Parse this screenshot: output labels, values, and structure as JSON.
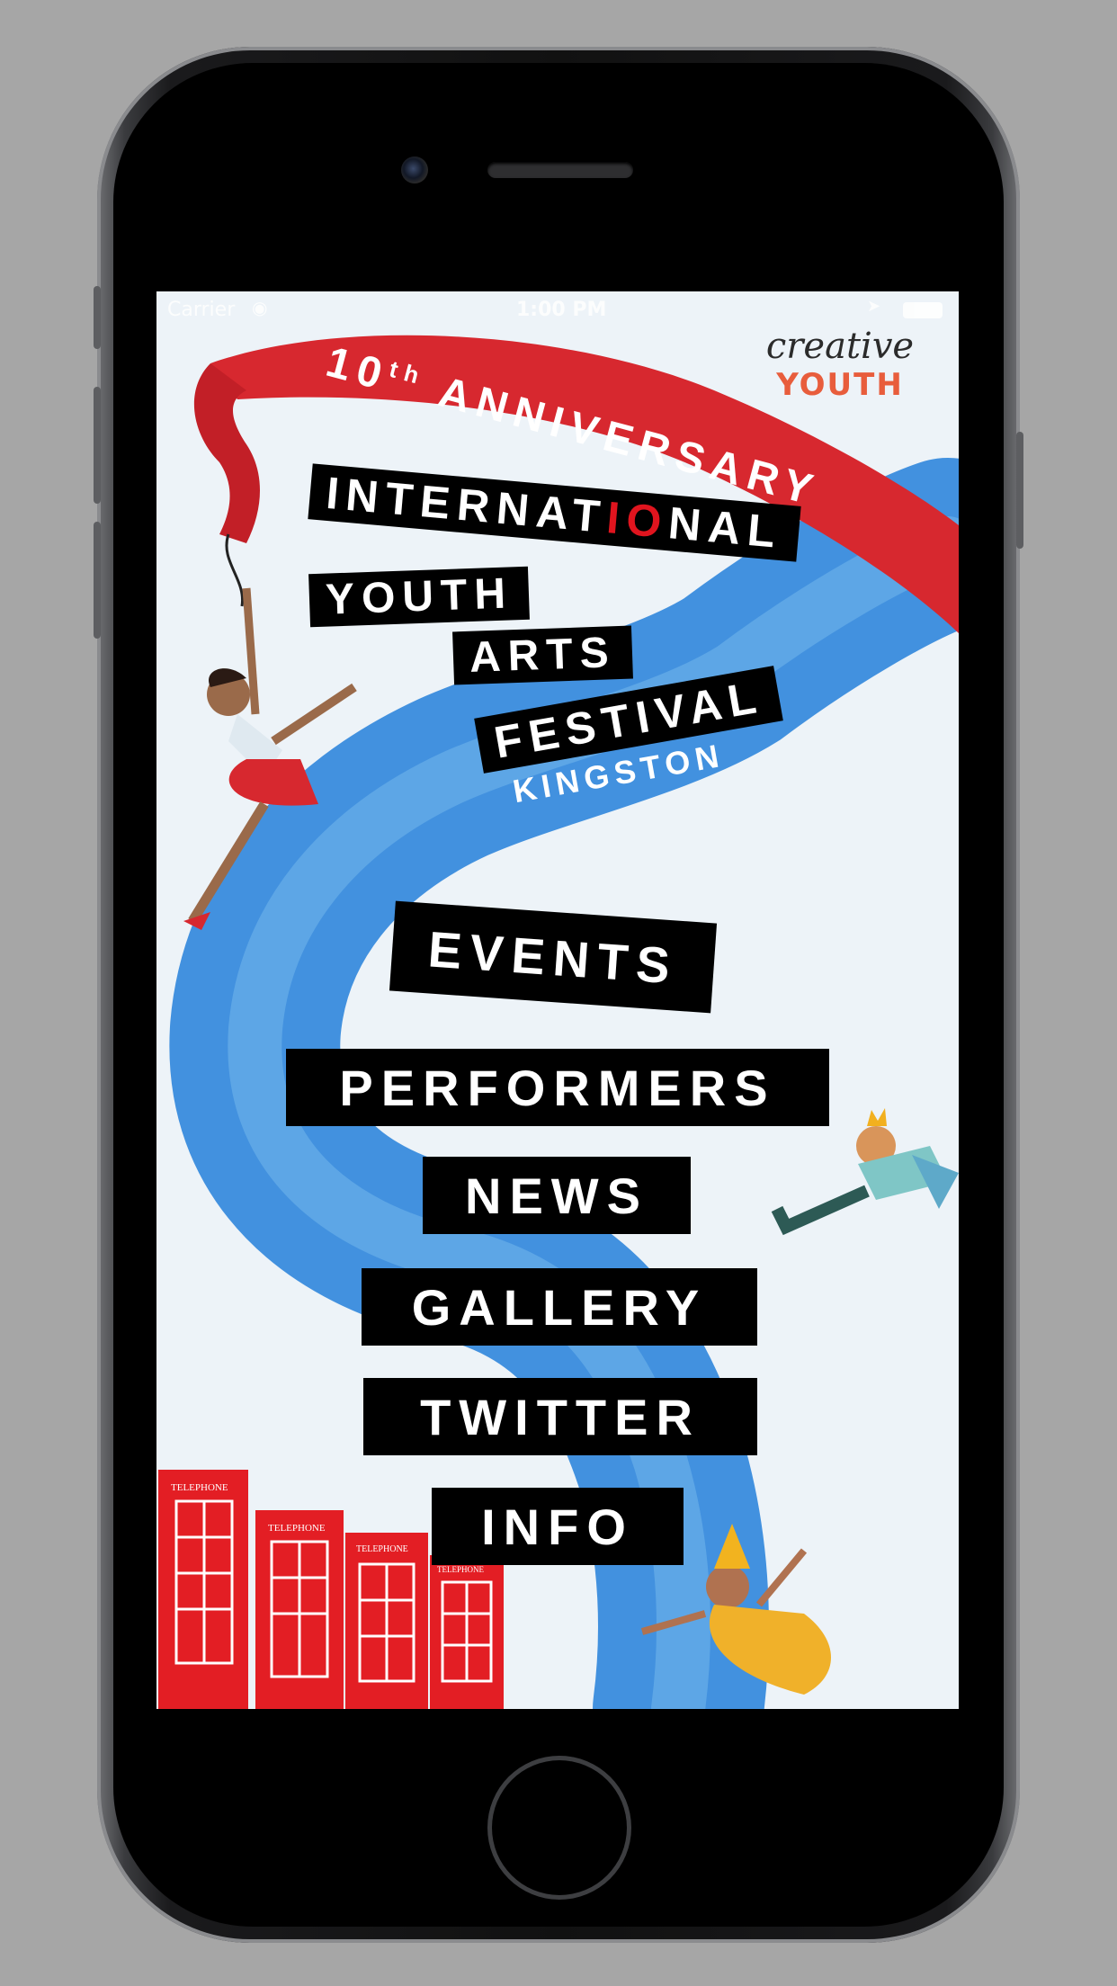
{
  "status_bar": {
    "carrier": "Carrier",
    "time": "1:00 PM"
  },
  "brand": {
    "script": "creative",
    "word": "YOUTH"
  },
  "ribbon": {
    "number": "10",
    "suffix": "th",
    "label": "ANNIVERSARY"
  },
  "festival_title": {
    "line1_a": "INTERNAT",
    "line1_accent": "IO",
    "line1_b": "NAL",
    "line2": "YOUTH",
    "line3": "ARTS",
    "line4": "FESTIVAL",
    "line5": "KINGSTON"
  },
  "menu": {
    "events": "EVENTS",
    "performers": "PERFORMERS",
    "news": "NEWS",
    "gallery": "GALLERY",
    "twitter": "TWITTER",
    "info": "INFO"
  },
  "phone_booths": {
    "label": "TELEPHONE"
  },
  "colors": {
    "ribbon_red": "#d7282f",
    "river_blue": "#2a7fd6",
    "background": "#edf3f8",
    "accent_red": "#e0141e"
  }
}
